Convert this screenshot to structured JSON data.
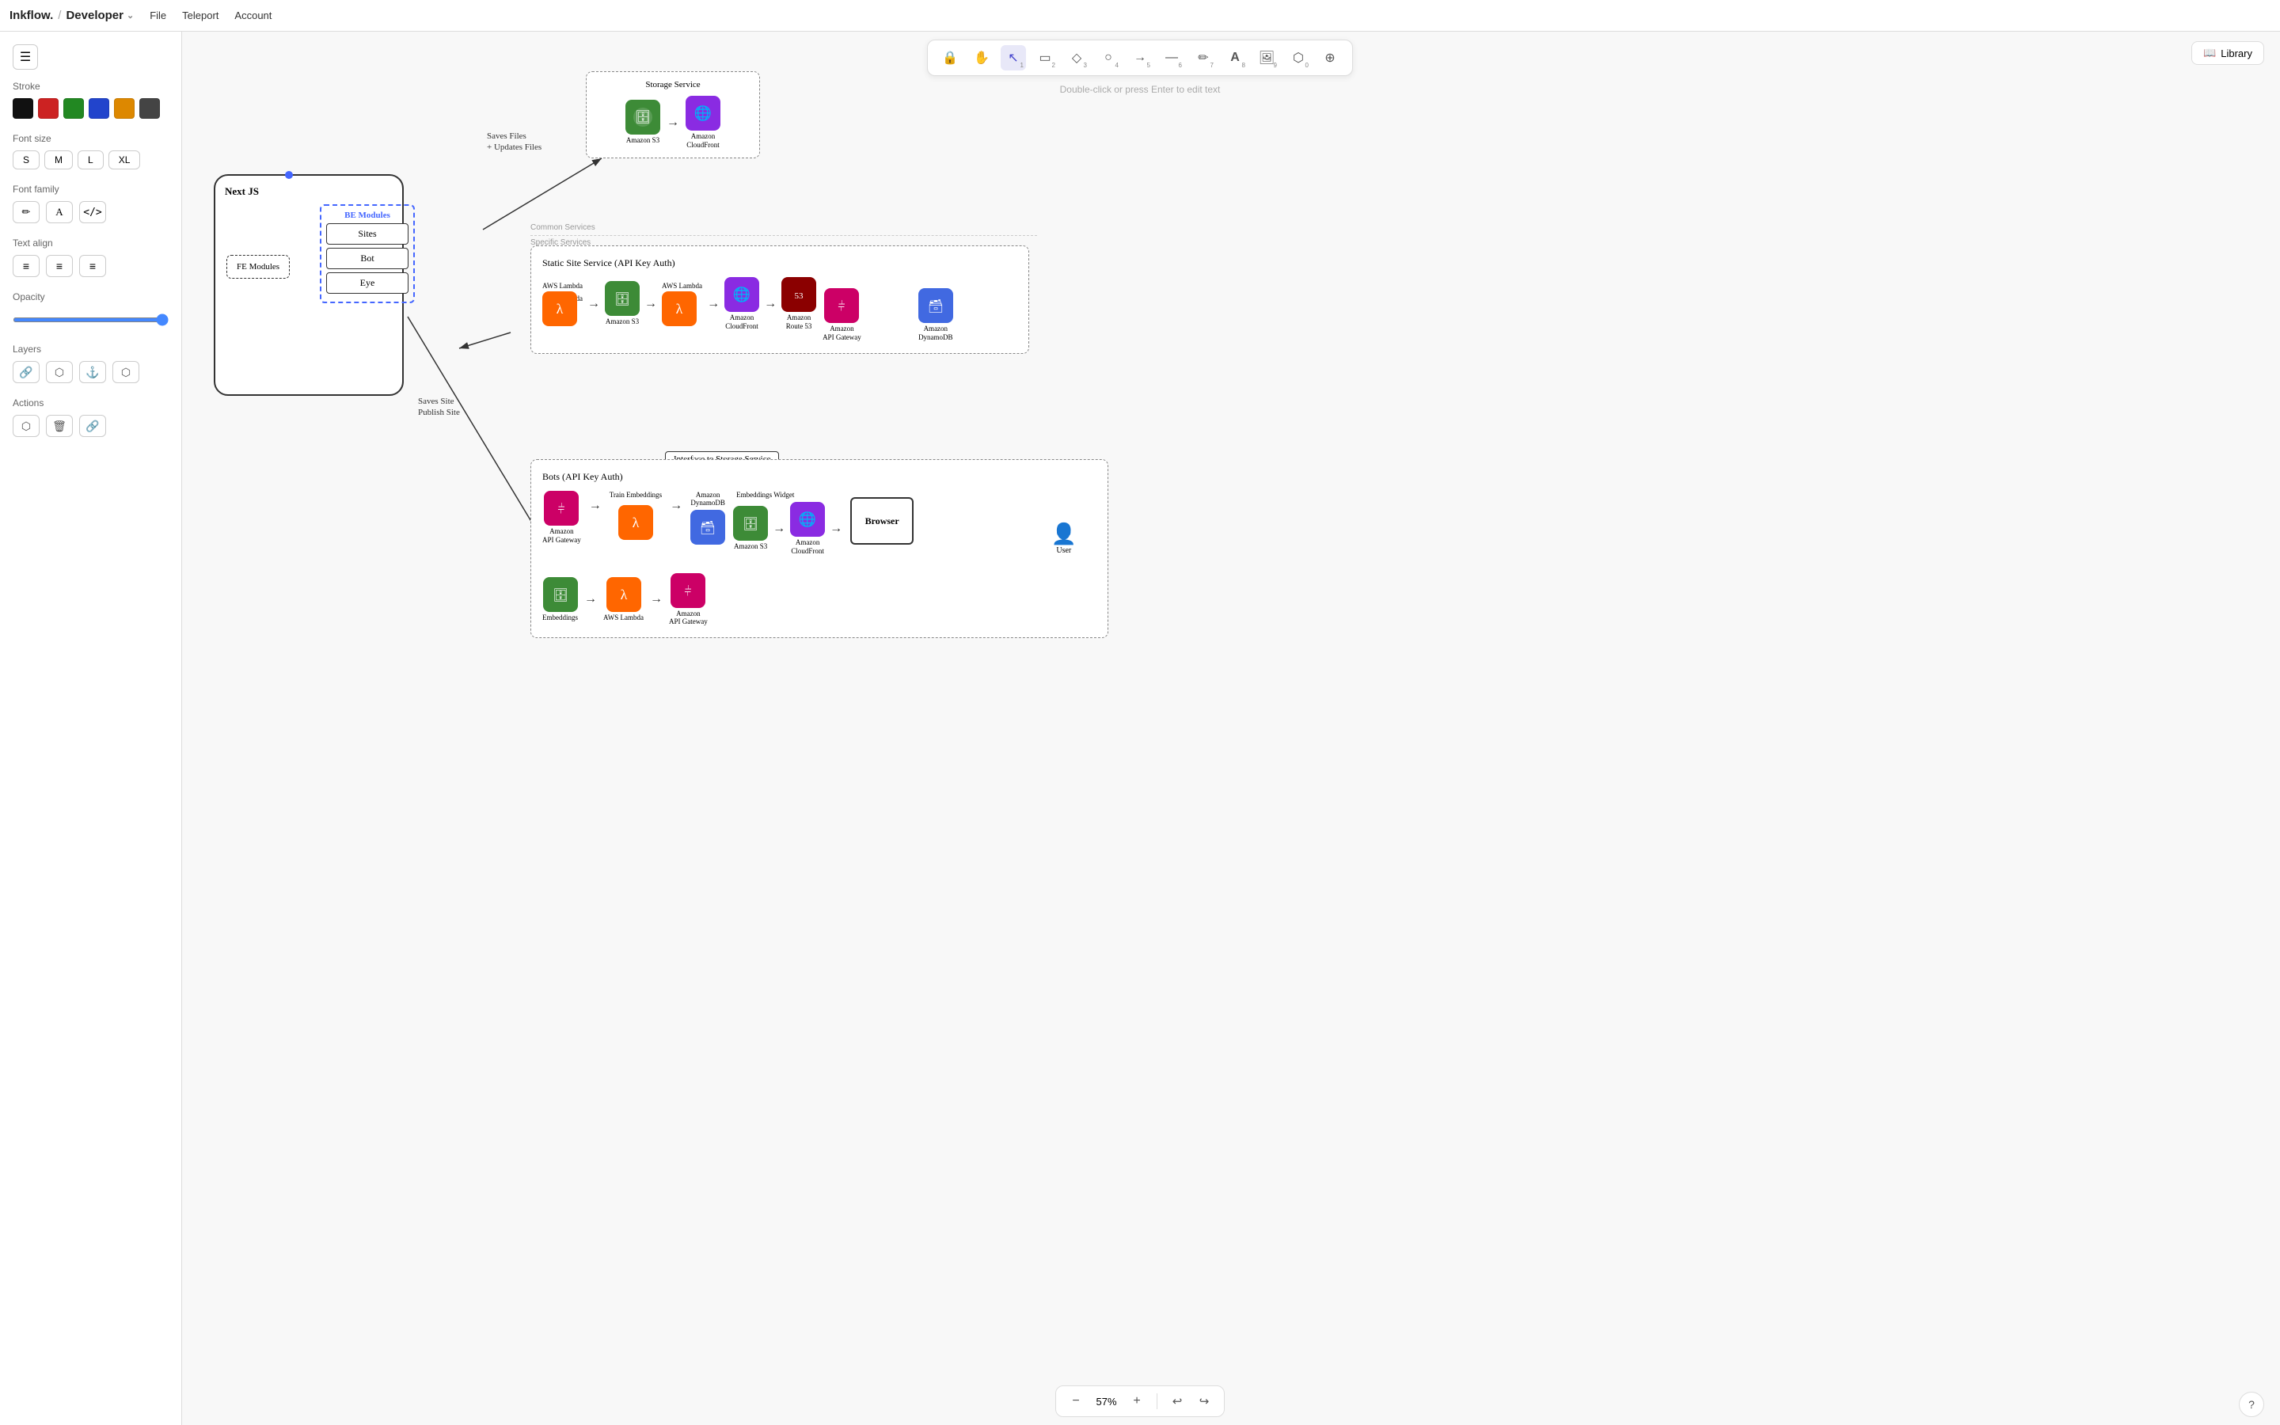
{
  "menubar": {
    "brand": "Inkflow.",
    "slash": "/",
    "project": "Developer",
    "menus": [
      "File",
      "Teleport",
      "Account"
    ]
  },
  "toolbar": {
    "tools": [
      {
        "name": "lock",
        "icon": "🔒",
        "sub": "",
        "active": false
      },
      {
        "name": "hand",
        "icon": "✋",
        "sub": "",
        "active": false
      },
      {
        "name": "select",
        "icon": "↖",
        "sub": "1",
        "active": true
      },
      {
        "name": "rectangle",
        "icon": "▭",
        "sub": "2",
        "active": false
      },
      {
        "name": "diamond",
        "icon": "◇",
        "sub": "3",
        "active": false
      },
      {
        "name": "ellipse",
        "icon": "○",
        "sub": "4",
        "active": false
      },
      {
        "name": "arrow",
        "icon": "→",
        "sub": "5",
        "active": false
      },
      {
        "name": "line",
        "icon": "—",
        "sub": "6",
        "active": false
      },
      {
        "name": "pen",
        "icon": "✏",
        "sub": "7",
        "active": false
      },
      {
        "name": "text",
        "icon": "A",
        "sub": "8",
        "active": false
      },
      {
        "name": "image",
        "icon": "🖼",
        "sub": "9",
        "active": false
      },
      {
        "name": "eraser",
        "icon": "◇",
        "sub": "0",
        "active": false
      },
      {
        "name": "more",
        "icon": "⊕",
        "sub": "",
        "active": false
      }
    ],
    "hint": "Double-click or press Enter to edit text",
    "library_label": "Library"
  },
  "left_panel": {
    "stroke_label": "Stroke",
    "colors": [
      "#111111",
      "#cc2222",
      "#228822",
      "#2244cc",
      "#dd8800",
      "#444444"
    ],
    "font_size_label": "Font size",
    "font_sizes": [
      "S",
      "M",
      "L",
      "XL"
    ],
    "font_family_label": "Font family",
    "text_align_label": "Text align",
    "opacity_label": "Opacity",
    "opacity_value": 100,
    "layers_label": "Layers",
    "actions_label": "Actions"
  },
  "zoom": {
    "level": "57%",
    "minus": "−",
    "plus": "+"
  },
  "diagram": {
    "nextjs_label": "Next JS",
    "be_modules_label": "BE Modules",
    "sites_label": "Sites",
    "bot_label": "Bot",
    "eye_label": "Eye",
    "fe_modules_label": "FE Modules",
    "storage_service_label": "Storage Service",
    "amazon_s3_label": "Amazon S3",
    "amazon_cloudfront_label": "Amazon CloudFront",
    "common_services_label": "Common Services",
    "specific_services_label": "Specific Services",
    "static_site_label": "Static Site Service (API Key Auth)",
    "aws_lambda_label": "AWS Lambda",
    "amazon_s3_2_label": "Amazon S3",
    "aws_lambda_2_label": "AWS Lambda",
    "amazon_cloudfront_2_label": "Amazon CloudFront",
    "amazon_route53_label": "Amazon Route 53",
    "amazon_gateway_label": "Amazon API Gateway",
    "amazon_dynamo_label": "Amazon DynamoDB",
    "interface_label": "Interface to Storage Service",
    "bots_label": "Bots (API Key Auth)",
    "train_embeddings_label": "Train Embeddings",
    "amazon_dynamo2_label": "Amazon DynamoDB",
    "embeddings_widget_label": "Embeddings Widget",
    "amazon_s3_3_label": "Amazon S3",
    "amazon_cloudfront_3_label": "Amazon CloudFront",
    "amazon_gateway2_label": "Amazon API Gateway",
    "embeddings_label": "Embeddings",
    "aws_lambda_3_label": "AWS Lambda",
    "amazon_gateway3_label": "Amazon API Gateway",
    "browser_label": "Browser",
    "user_label": "User",
    "saves_files_label": "Saves Files\n+ Updates Files",
    "saves_site_label": "Saves Site\nPublish Site"
  }
}
